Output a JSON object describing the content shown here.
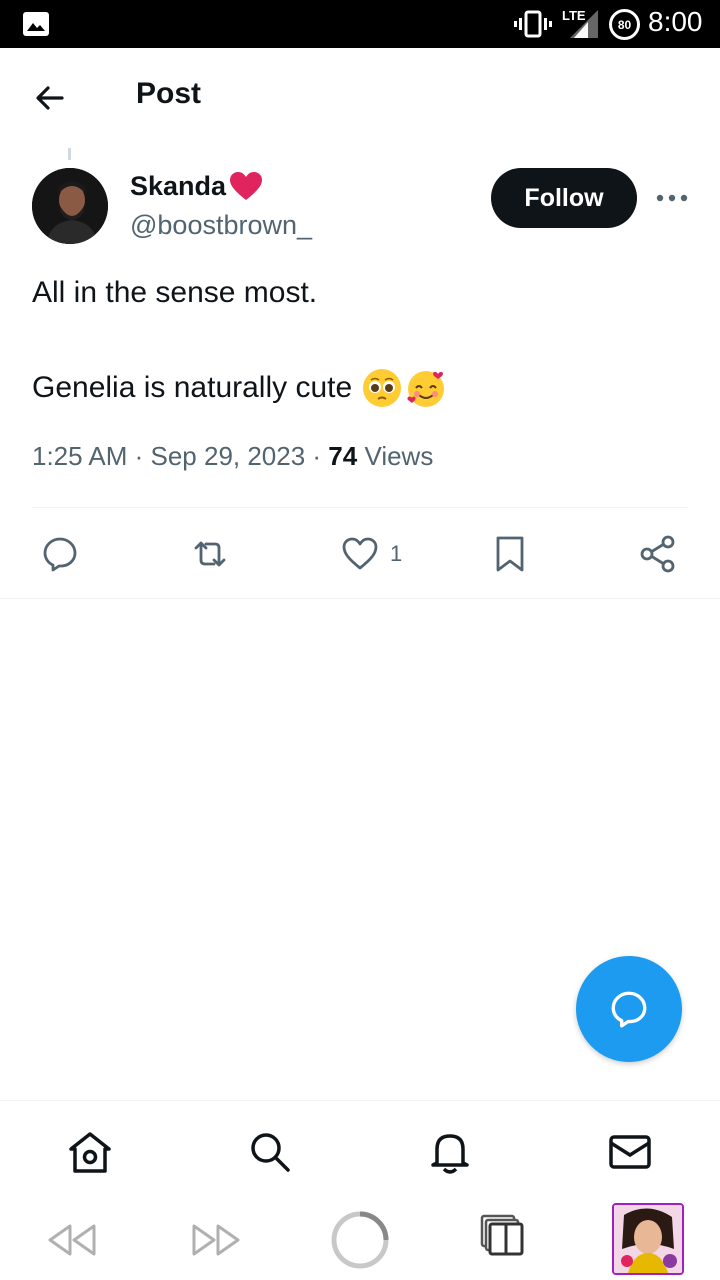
{
  "status_bar": {
    "network": "LTE",
    "battery": "80",
    "time": "8:00",
    "icons": [
      "gallery-icon",
      "vibrate-icon",
      "signal-icon",
      "battery-icon"
    ]
  },
  "header": {
    "title": "Post",
    "back_icon": "arrow-left-icon"
  },
  "tweet": {
    "display_name": "Skanda",
    "name_emoji": "red-heart",
    "handle": "@boostbrown_",
    "follow_label": "Follow",
    "text_line1": "All in the sense most.",
    "text_line2": "Genelia is naturally cute",
    "text_emojis": [
      "pleading-face",
      "smiling-face-with-hearts"
    ],
    "timestamp": "1:25 AM · Sep 29, 2023 · ",
    "views_count": "74",
    "views_label": " Views"
  },
  "actions": {
    "reply_icon": "reply-icon",
    "retweet_icon": "retweet-icon",
    "like_icon": "heart-icon",
    "like_count": "1",
    "bookmark_icon": "bookmark-icon",
    "share_icon": "share-icon"
  },
  "bottom_nav": [
    "home-icon",
    "search-icon",
    "bell-icon",
    "mail-icon"
  ],
  "system_bar": [
    "rewind-icon",
    "fast-forward-icon",
    "home-circle-icon",
    "recents-icon",
    "app-thumbnail"
  ],
  "colors": {
    "accent": "#1d9bf0",
    "text_primary": "#0f1419",
    "text_secondary": "#536471",
    "heart_red": "#e0245e"
  }
}
